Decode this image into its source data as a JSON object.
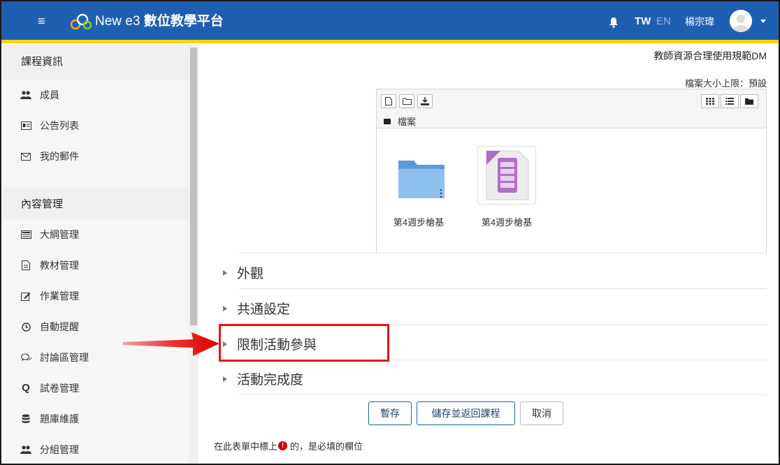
{
  "header": {
    "menu_icon": "hamburger-icon",
    "logo_icon": "cloud-logo-icon",
    "brand_prefix": "New e3",
    "brand_suffix": "數位教學平台",
    "bell_icon": "bell-icon",
    "lang_tw": "TW",
    "lang_en": "EN",
    "user_name": "楊宗瑋",
    "brand_color": "#1f5fb1",
    "accent_color": "#f5d500"
  },
  "sidebar": {
    "section1_title": "課程資訊",
    "items1": [
      {
        "label": "成員",
        "icon": "users-icon"
      },
      {
        "label": "公告列表",
        "icon": "announcement-icon"
      },
      {
        "label": "我的郵件",
        "icon": "envelope-icon"
      }
    ],
    "section2_title": "內容管理",
    "items2": [
      {
        "label": "大綱管理",
        "icon": "syllabus-icon"
      },
      {
        "label": "教材管理",
        "icon": "document-icon"
      },
      {
        "label": "作業管理",
        "icon": "edit-icon"
      },
      {
        "label": "自動提醒",
        "icon": "clock-icon"
      },
      {
        "label": "討論區管理",
        "icon": "comments-icon"
      },
      {
        "label": "試卷管理",
        "icon": "quiz-icon"
      },
      {
        "label": "題庫維護",
        "icon": "database-icon"
      },
      {
        "label": "分組管理",
        "icon": "group-icon"
      }
    ]
  },
  "main": {
    "link_text": "教師資源合理使用規範DM",
    "size_limit": "檔案大小上限：預設",
    "filemanager": {
      "crumb": "檔案",
      "files": [
        {
          "name": "第4週步槍基",
          "type": "folder-icon"
        },
        {
          "name": "第4週步槍基",
          "type": "archive-file-icon"
        }
      ]
    },
    "sections": [
      "外觀",
      "共通設定",
      "限制活動參與",
      "活動完成度"
    ],
    "buttons": {
      "save": "暫存",
      "save_return": "儲存並返回課程",
      "cancel": "取消"
    },
    "required_note_pre": "在此表單中標上",
    "required_note_post": " 的，是必填的欄位"
  }
}
